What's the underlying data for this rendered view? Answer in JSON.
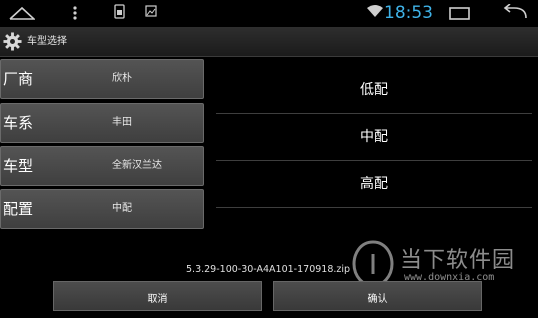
{
  "status_bar": {
    "time": "18:53"
  },
  "title_bar": {
    "title": "车型选择"
  },
  "settings": [
    {
      "label": "厂商",
      "value": "欣朴"
    },
    {
      "label": "车系",
      "value": "丰田"
    },
    {
      "label": "车型",
      "value": "全新汉兰达"
    },
    {
      "label": "配置",
      "value": "中配"
    }
  ],
  "options": [
    "低配",
    "中配",
    "高配"
  ],
  "version": "5.3.29-100-30-A4A101-170918.zip",
  "buttons": {
    "cancel": "取消",
    "confirm": "确认"
  },
  "watermark": {
    "text": "当下软件园",
    "url": "www.downxia.com"
  },
  "colors": {
    "accent": "#3fb3e8",
    "background": "#000000"
  }
}
